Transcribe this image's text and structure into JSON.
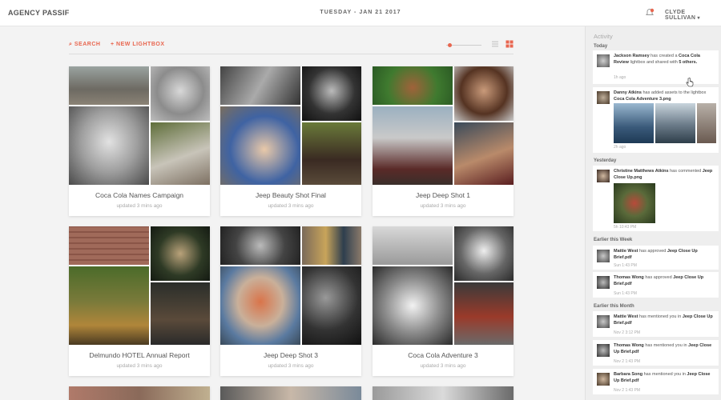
{
  "topbar": {
    "brand": "AGENCY PASSIF",
    "date": "TUESDAY - JAN 21 2017",
    "user_name": "CLYDE SULLIVAN",
    "user_chevron": "▾",
    "bell_icon": "bell-icon",
    "accent": "#e8664f"
  },
  "toolbar": {
    "search_label": "SEARCH",
    "search_icon": "⌕",
    "new_lightbox_label": "NEW LIGHTBOX",
    "new_lightbox_icon": "+",
    "zoom_fraction": 0.05
  },
  "cards": [
    {
      "title": "Coca Cola Names Campaign",
      "updated": "updated 3 mins ago"
    },
    {
      "title": "Jeep Beauty Shot Final",
      "updated": "updated 3 mins ago"
    },
    {
      "title": "Jeep Deep Shot 1",
      "updated": "updated 3 mins ago"
    },
    {
      "title": "Delmundo HOTEL Annual Report",
      "updated": "updated 3 mins ago"
    },
    {
      "title": "Jeep Deep Shot 3",
      "updated": "updated 3 mins ago"
    },
    {
      "title": "Coca Cola Adventure 3",
      "updated": "updated 3 mins ago"
    }
  ],
  "sidebar": {
    "title": "Activity",
    "sections": {
      "today": "Today",
      "yesterday": "Yesterday",
      "earlier_week": "Earlier this Week",
      "earlier_month": "Earlier this Month"
    },
    "items": [
      {
        "user": "Jackson Ramsey",
        "pre": " has created a ",
        "obj": "Coca Cola Review",
        "mid": " lightbox and shared with ",
        "extra": "5 others.",
        "time": "1h ago"
      },
      {
        "user": "Danny Atkins",
        "pre": " has added assets to the lightbox ",
        "obj": "Coca Cola Adventure 3.png",
        "mid": "",
        "extra": "",
        "time": "2h ago"
      },
      {
        "user": "Christine Matthews Atkins",
        "pre": " has commented ",
        "obj": "Jeep Close Up.png",
        "mid": "",
        "extra": "",
        "time": "5h 10:43 PM"
      },
      {
        "user": "Mattie West",
        "pre": " has approved ",
        "obj": "Jeep Close Up Brief.pdf",
        "mid": "",
        "extra": "",
        "time": "Sun 1:43 PM"
      },
      {
        "user": "Thomas Wong",
        "pre": " has approved ",
        "obj": "Jeep Close Up Brief.pdf",
        "mid": "",
        "extra": "",
        "time": "Sun 1:43 PM"
      },
      {
        "user": "Mattie West",
        "pre": " has mentioned you in ",
        "obj": "Jeep Close Up Brief.pdf",
        "mid": "",
        "extra": "",
        "time": "Nov 2 3:12 PM"
      },
      {
        "user": "Thomas Wong",
        "pre": " has mentioned you in ",
        "obj": "Jeep Close Up Brief.pdf",
        "mid": "",
        "extra": "",
        "time": "Nov 2 1:43 PM"
      },
      {
        "user": "Barbara Song",
        "pre": " has mentioned you in ",
        "obj": "Jeep Close Up Brief.pdf",
        "mid": "",
        "extra": "",
        "time": "Nov 2 1:43 PM"
      }
    ]
  }
}
